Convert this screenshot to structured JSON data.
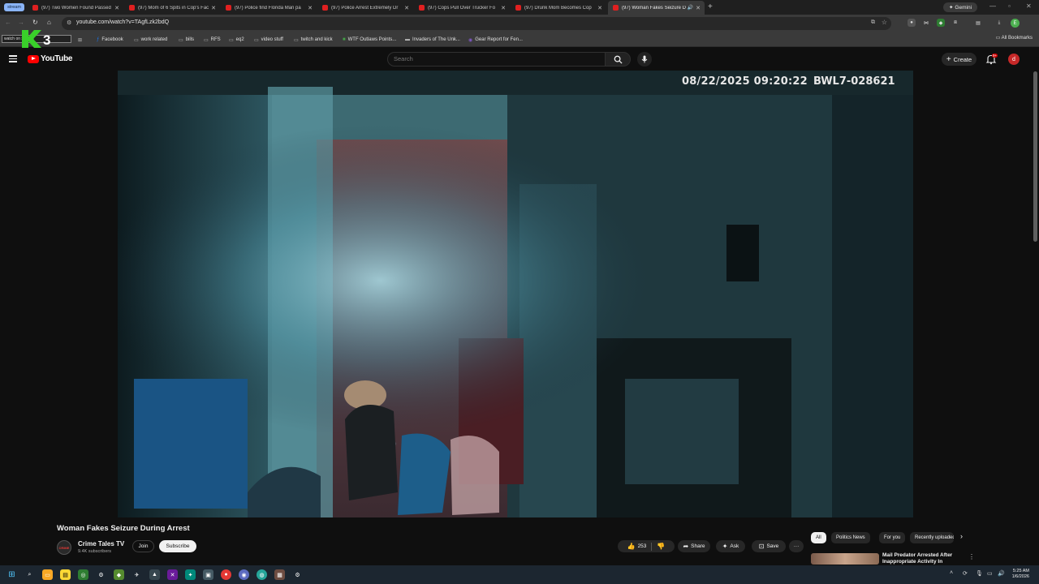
{
  "browser": {
    "tab_group": "stream",
    "tabs": [
      {
        "title": "(97) Two Women Found Passed",
        "active": false
      },
      {
        "title": "(97) Mom of 6 Spits in Cop's Face",
        "active": false
      },
      {
        "title": "(97) Police find Florida Man pa",
        "active": false
      },
      {
        "title": "(97) Police Arrest Extremely Dr",
        "active": false
      },
      {
        "title": "(97) Cops Pull Over Trucker Fo",
        "active": false
      },
      {
        "title": "(97) Drunk Mom Becomes Cop",
        "active": false
      },
      {
        "title": "(97) Woman Fakes Seizure D",
        "active": true
      }
    ],
    "new_tab": "+",
    "gemini_label": "Gemini",
    "url": "youtube.com/watch?v=TAgfLzk2bdQ",
    "profile_initial": "E",
    "bookmarks": [
      {
        "label": "Facebook",
        "icon": "facebook-icon"
      },
      {
        "label": "work related",
        "icon": "folder-icon"
      },
      {
        "label": "bills",
        "icon": "folder-icon"
      },
      {
        "label": "RFS",
        "icon": "folder-icon"
      },
      {
        "label": "eq2",
        "icon": "folder-icon"
      },
      {
        "label": "video stuff",
        "icon": "folder-icon"
      },
      {
        "label": "twitch and kick",
        "icon": "folder-icon"
      },
      {
        "label": "WTF Outlaws Points...",
        "icon": "green-square-icon"
      },
      {
        "label": "Invaders of The Unk...",
        "icon": "bookmark-icon"
      },
      {
        "label": "Gear Report for Fen...",
        "icon": "bookmark-icon"
      }
    ],
    "bookmark_overlay_text": "watch on stream",
    "all_bookmarks": "All Bookmarks"
  },
  "youtube": {
    "logo_text": "YouTube",
    "search_placeholder": "Search",
    "create_label": "Create",
    "notification_count": "9+",
    "avatar_initial": "d",
    "video": {
      "timestamp_overlay": "08/22/2025 09:20:22",
      "camera_id": "BWL7-028621",
      "title": "Woman Fakes Seizure During Arrest"
    },
    "channel": {
      "name": "Crime Tales TV",
      "subscribers": "9.4K subscribers",
      "avatar_text": "CRIME",
      "join_label": "Join",
      "subscribe_label": "Subscribe"
    },
    "actions": {
      "likes": "253",
      "share_label": "Share",
      "ask_label": "Ask",
      "save_label": "Save",
      "more_label": "···"
    },
    "chips": [
      "All",
      "Politics News",
      "For you",
      "Recently uploaded"
    ],
    "recommendation": {
      "title": "Mail Predator Arrested After Inappropriate Activity In"
    }
  },
  "taskbar": {
    "time": "5:25 AM",
    "date": "1/6/2026"
  },
  "colors": {
    "youtube_red": "#ff0000",
    "page_background": "#0f0f0f",
    "chrome_tab_bar": "#1f1f1f",
    "chrome_toolbar": "#3a3a3a"
  }
}
